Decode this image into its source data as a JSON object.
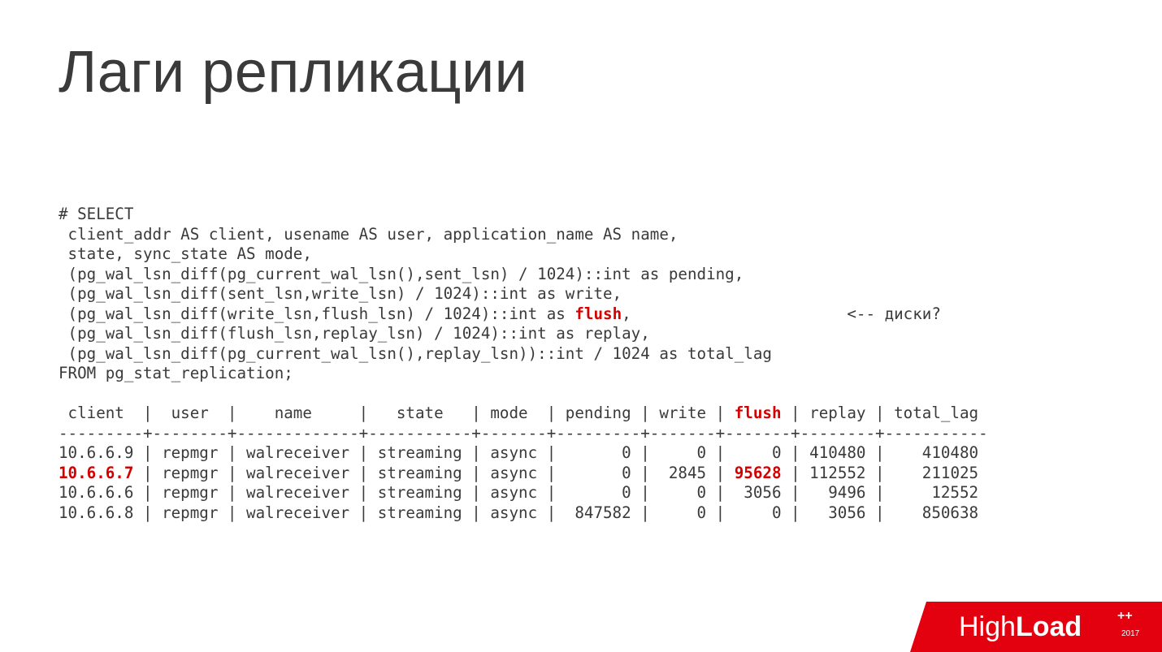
{
  "title": "Лаги репликации",
  "sql": {
    "l1": "# SELECT",
    "l2": " client_addr AS client, usename AS user, application_name AS name,",
    "l3": " state, sync_state AS mode,",
    "l4": " (pg_wal_lsn_diff(pg_current_wal_lsn(),sent_lsn) / 1024)::int as pending,",
    "l5": " (pg_wal_lsn_diff(sent_lsn,write_lsn) / 1024)::int as write,",
    "l6a": " (pg_wal_lsn_diff(write_lsn,flush_lsn) / 1024)::int as ",
    "l6b": "flush",
    "l6c": ",                       <-- диски?",
    "l7": " (pg_wal_lsn_diff(flush_lsn,replay_lsn) / 1024)::int as replay,",
    "l8": " (pg_wal_lsn_diff(pg_current_wal_lsn(),replay_lsn))::int / 1024 as total_lag",
    "l9": "FROM pg_stat_replication;"
  },
  "table": {
    "header_a": " client  |  user  |    name     |   state   | mode  | pending | write | ",
    "header_flush": "flush",
    "header_b": " | replay | total_lag",
    "sep": "---------+--------+-------------+-----------+-------+---------+-------+-------+--------+-----------",
    "r1": "10.6.6.9 | repmgr | walreceiver | streaming | async |       0 |     0 |     0 | 410480 |    410480",
    "r2_ip": "10.6.6.7",
    "r2_mid": " | repmgr | walreceiver | streaming | async |       0 |  2845 | ",
    "r2_flush": "95628",
    "r2_end": " | 112552 |    211025",
    "r3": "10.6.6.6 | repmgr | walreceiver | streaming | async |       0 |     0 |  3056 |   9496 |     12552",
    "r4": "10.6.6.8 | repmgr | walreceiver | streaming | async |  847582 |     0 |     0 |   3056 |    850638"
  },
  "chart_data": {
    "type": "table",
    "columns": [
      "client",
      "user",
      "name",
      "state",
      "mode",
      "pending",
      "write",
      "flush",
      "replay",
      "total_lag"
    ],
    "rows": [
      {
        "client": "10.6.6.9",
        "user": "repmgr",
        "name": "walreceiver",
        "state": "streaming",
        "mode": "async",
        "pending": 0,
        "write": 0,
        "flush": 0,
        "replay": 410480,
        "total_lag": 410480
      },
      {
        "client": "10.6.6.7",
        "user": "repmgr",
        "name": "walreceiver",
        "state": "streaming",
        "mode": "async",
        "pending": 0,
        "write": 2845,
        "flush": 95628,
        "replay": 112552,
        "total_lag": 211025
      },
      {
        "client": "10.6.6.6",
        "user": "repmgr",
        "name": "walreceiver",
        "state": "streaming",
        "mode": "async",
        "pending": 0,
        "write": 0,
        "flush": 3056,
        "replay": 9496,
        "total_lag": 12552
      },
      {
        "client": "10.6.6.8",
        "user": "repmgr",
        "name": "walreceiver",
        "state": "streaming",
        "mode": "async",
        "pending": 847582,
        "write": 0,
        "flush": 0,
        "replay": 3056,
        "total_lag": 850638
      }
    ]
  },
  "logo": {
    "thin": "High",
    "bold": "Load",
    "plus": "++",
    "year": "2017"
  }
}
